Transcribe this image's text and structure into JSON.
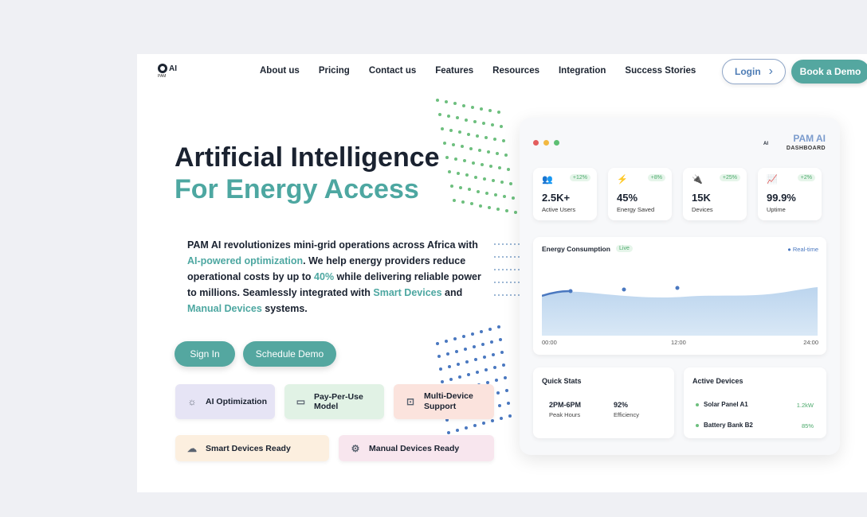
{
  "logo": {
    "mark": "AI",
    "sub": "PAM"
  },
  "nav": [
    "About us",
    "Pricing",
    "Contact us",
    "Features",
    "Resources",
    "Integration",
    "Success Stories"
  ],
  "header": {
    "login_label": "Login",
    "demo_label": "Book a Demo"
  },
  "hero": {
    "title_line1": "Artificial Intelligence",
    "title_line2": "For Energy Access",
    "desc": {
      "p1": "PAM AI revolutionizes mini-grid operations across Africa with ",
      "h1": "AI-powered optimization",
      "p2": ". We help energy providers reduce operational costs by up to ",
      "h2": "40%",
      "p3": " while delivering reliable power to millions. Seamlessly integrated with ",
      "h3": "Smart Devices",
      "p4": " and ",
      "h4": "Manual Devices",
      "p5": " systems."
    },
    "signin_label": "Sign In",
    "schedule_label": "Schedule Demo"
  },
  "features": [
    {
      "label": "AI Optimization",
      "icon": "lightbulb-icon",
      "glyph": "☼",
      "bg": "#e6e4f5"
    },
    {
      "label": "Pay-Per-Use Model",
      "icon": "credit-card-icon",
      "glyph": "▭",
      "bg": "#e1f2e5"
    },
    {
      "label": "Multi-Device Support",
      "icon": "terminal-icon",
      "glyph": "⊡",
      "bg": "#fbe3dd"
    },
    {
      "label": "Smart Devices Ready",
      "icon": "cloud-icon",
      "glyph": "☁",
      "bg": "#fcefdf"
    },
    {
      "label": "Manual Devices Ready",
      "icon": "gear-icon",
      "glyph": "⚙",
      "bg": "#f8e6ee"
    }
  ],
  "dashboard": {
    "title": "PAM AI",
    "subtitle": "DASHBOARD",
    "logo_text": "AI",
    "window_dots": [
      "#e35d5d",
      "#f2b840",
      "#5dbf73"
    ],
    "stats": [
      {
        "icon": "users-icon",
        "glyph": "👥",
        "delta": "+12%",
        "value": "2.5K+",
        "label": "Active Users"
      },
      {
        "icon": "lightning-icon",
        "glyph": "⚡",
        "delta": "+8%",
        "value": "45%",
        "label": "Energy Saved"
      },
      {
        "icon": "plug-icon",
        "glyph": "🔌",
        "delta": "+25%",
        "value": "15K",
        "label": "Devices"
      },
      {
        "icon": "chart-icon",
        "glyph": "📈",
        "delta": "+2%",
        "value": "99.9%",
        "label": "Uptime"
      }
    ],
    "consumption": {
      "title": "Energy Consumption",
      "badge": "Live",
      "realtime": "● Real-time",
      "x_labels": [
        "00:00",
        "12:00",
        "24:00"
      ]
    },
    "quick_stats": {
      "title": "Quick Stats",
      "items": [
        {
          "value": "2PM-6PM",
          "label": "Peak Hours"
        },
        {
          "value": "92%",
          "label": "Efficiency"
        }
      ]
    },
    "active_devices": {
      "title": "Active Devices",
      "items": [
        {
          "name": "Solar Panel A1",
          "value": "1.2kW"
        },
        {
          "name": "Battery Bank B2",
          "value": "85%"
        }
      ]
    }
  }
}
